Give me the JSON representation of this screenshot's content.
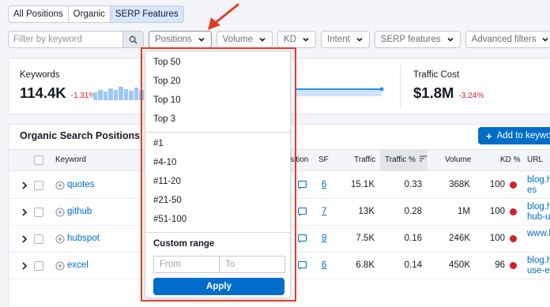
{
  "tabs": [
    "All Positions",
    "Organic",
    "SERP Features"
  ],
  "search": {
    "placeholder": "Filter by keyword"
  },
  "filters": [
    "Positions",
    "Volume",
    "KD",
    "Intent",
    "SERP features",
    "Advanced filters"
  ],
  "stats": {
    "keywords_label": "Keywords",
    "keywords_value": "114.4K",
    "keywords_delta": "-1.31%",
    "cost_label": "Traffic Cost",
    "cost_value": "$1.8M",
    "cost_delta": "-3.24%"
  },
  "table": {
    "title": "Organic Search Positions",
    "add_button": "Add to keyword",
    "columns": [
      "Keyword",
      "sition",
      "SF",
      "Traffic",
      "Traffic %",
      "Volume",
      "KD %",
      "URL"
    ],
    "rows": [
      {
        "keyword": "quotes",
        "sf": "6",
        "traffic": "15.1K",
        "pct": "0.33",
        "volume": "368K",
        "kd": "100",
        "url1": "blog.h",
        "url2": "es"
      },
      {
        "keyword": "github",
        "sf": "7",
        "traffic": "13K",
        "pct": "0.28",
        "volume": "1M",
        "kd": "100",
        "url1": "blog.h",
        "url2": "hub-u"
      },
      {
        "keyword": "hubspot",
        "sf": "9",
        "traffic": "7.5K",
        "pct": "0.16",
        "volume": "246K",
        "kd": "100",
        "url1": "www.l",
        "url2": ""
      },
      {
        "keyword": "excel",
        "sf": "6",
        "traffic": "6.8K",
        "pct": "0.14",
        "volume": "450K",
        "kd": "96",
        "url1": "blog.h",
        "url2": "use-ex"
      }
    ]
  },
  "positions_menu": {
    "group1": [
      "Top 50",
      "Top 20",
      "Top 10",
      "Top 3"
    ],
    "group2": [
      "#1",
      "#4-10",
      "#11-20",
      "#21-50",
      "#51-100"
    ],
    "custom_range_label": "Custom range",
    "from_placeholder": "From",
    "to_placeholder": "To",
    "apply_label": "Apply"
  },
  "colors": {
    "accent": "#006dca",
    "negative": "#d1212c",
    "highlight": "#e53b23"
  },
  "chart_bars": [
    0.55,
    0.7,
    0.6,
    0.85,
    0.75,
    0.95,
    0.8,
    0.65,
    0.9,
    0.7,
    0.6
  ]
}
